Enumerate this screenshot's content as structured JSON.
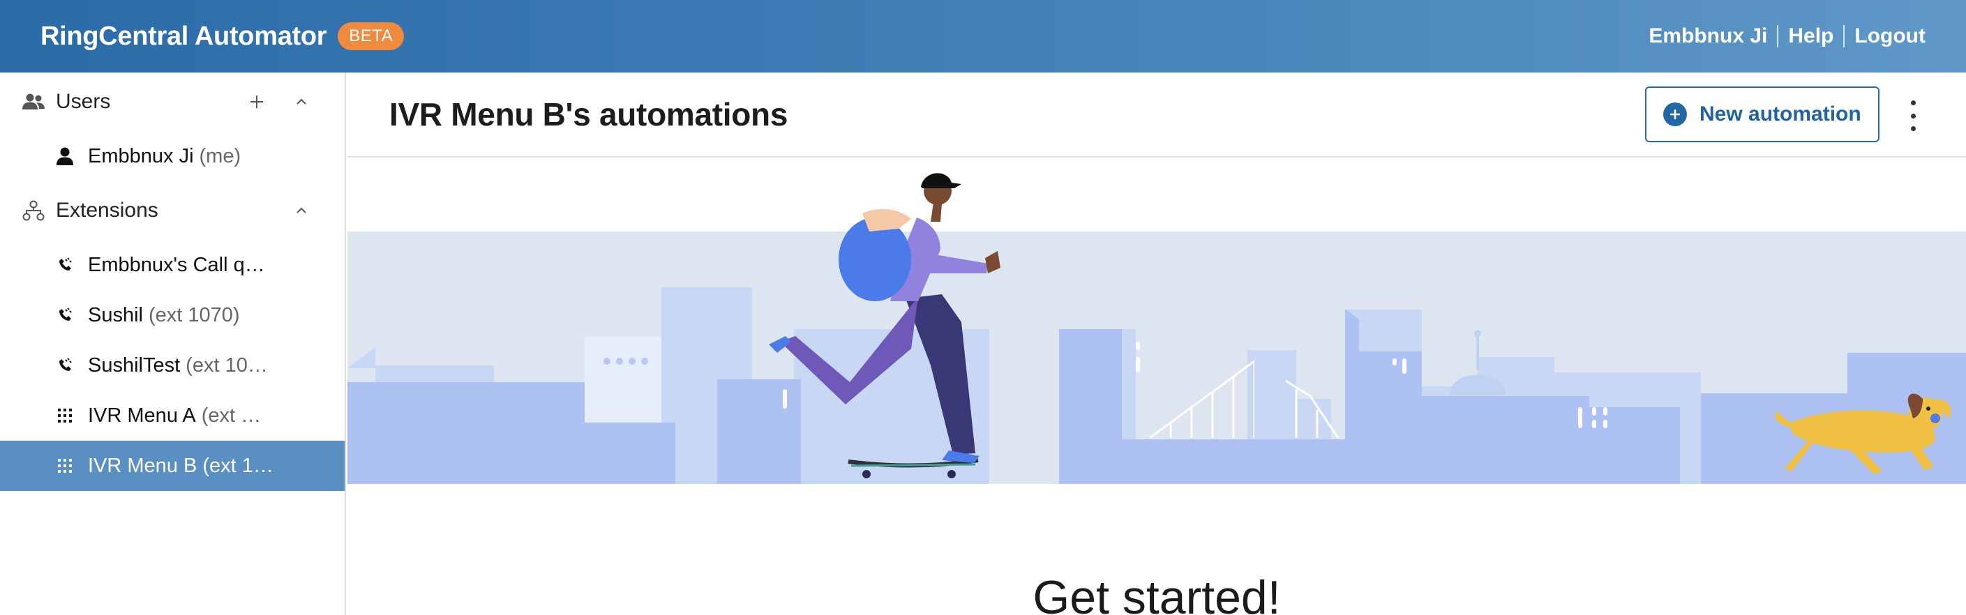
{
  "app": {
    "title": "RingCentral Automator",
    "badge": "BETA",
    "user_name": "Embbnux Ji",
    "help": "Help",
    "logout": "Logout"
  },
  "sidebar": {
    "users": {
      "label": "Users",
      "items": [
        {
          "label": "Embbnux Ji",
          "sub": "(me)",
          "icon": "person-icon"
        }
      ]
    },
    "extensions": {
      "label": "Extensions",
      "items": [
        {
          "label": "Embbnux's Call q…",
          "sub": "",
          "icon": "call-queue-icon"
        },
        {
          "label": "Sushil",
          "sub": "(ext 1070)",
          "icon": "call-queue-icon"
        },
        {
          "label": "SushilTest",
          "sub": "(ext 10…",
          "icon": "call-queue-icon"
        },
        {
          "label": "IVR Menu A",
          "sub": "(ext …",
          "icon": "dialpad-icon"
        },
        {
          "label": "IVR Menu B (ext 1…",
          "sub": "",
          "icon": "dialpad-icon",
          "selected": true
        }
      ]
    }
  },
  "main": {
    "title": "IVR Menu B's automations",
    "new_automation": "New automation",
    "get_started": "Get started!"
  },
  "colors": {
    "header_start": "#2a6ba8",
    "header_end": "#5f98c7",
    "beta_badge": "#f08a3e",
    "selected_item": "#5a8fc3",
    "accent": "#2366a6"
  }
}
